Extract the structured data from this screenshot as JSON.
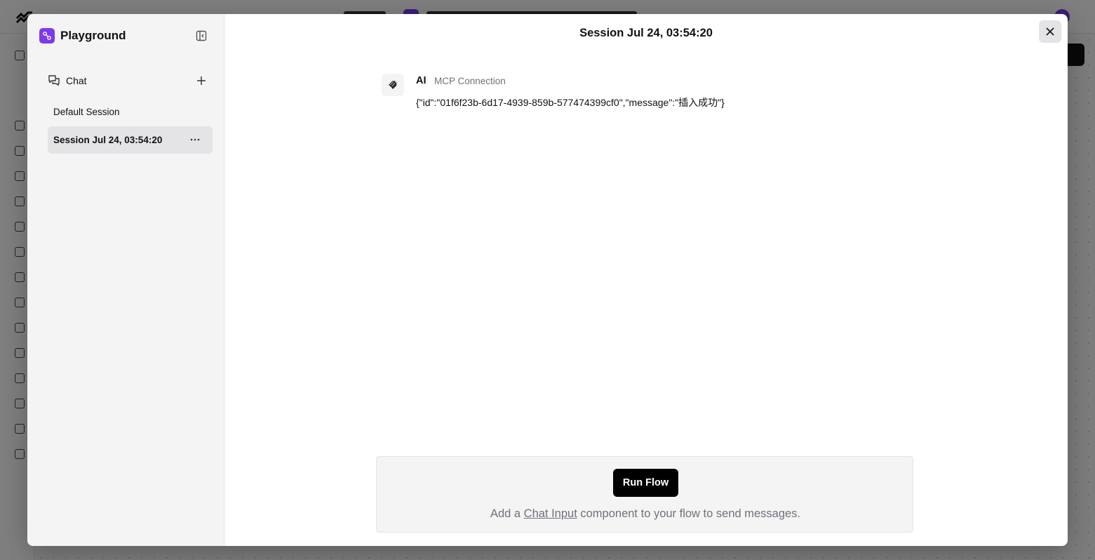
{
  "sidebar": {
    "title": "Playground",
    "chat_label": "Chat",
    "sessions": [
      {
        "label": "Default Session",
        "active": false
      },
      {
        "label": "Session Jul 24, 03:54:20",
        "active": true
      }
    ]
  },
  "main": {
    "title": "Session Jul 24, 03:54:20",
    "message": {
      "sender": "AI",
      "source": "MCP Connection",
      "text": "{\"id\":\"01f6f23b-6d17-4939-859b-577474399cf0\",\"message\":\"插入成功\"}"
    },
    "input_panel": {
      "run_button_label": "Run Flow",
      "hint_prefix": "Add a ",
      "hint_link": "Chat Input",
      "hint_suffix": " component to your flow to send messages."
    }
  },
  "colors": {
    "accent": "#7c3aed",
    "overlay": "rgba(0,0,0,0.5)",
    "button_dark": "#000000"
  },
  "icons": {
    "brand": "playground-icon",
    "collapse": "sidebar-collapse-icon",
    "chat": "chat-bubbles-icon",
    "new_chat": "plus-icon",
    "more": "more-horizontal-icon",
    "close": "close-icon",
    "bot": "bot-avatar-icon"
  }
}
